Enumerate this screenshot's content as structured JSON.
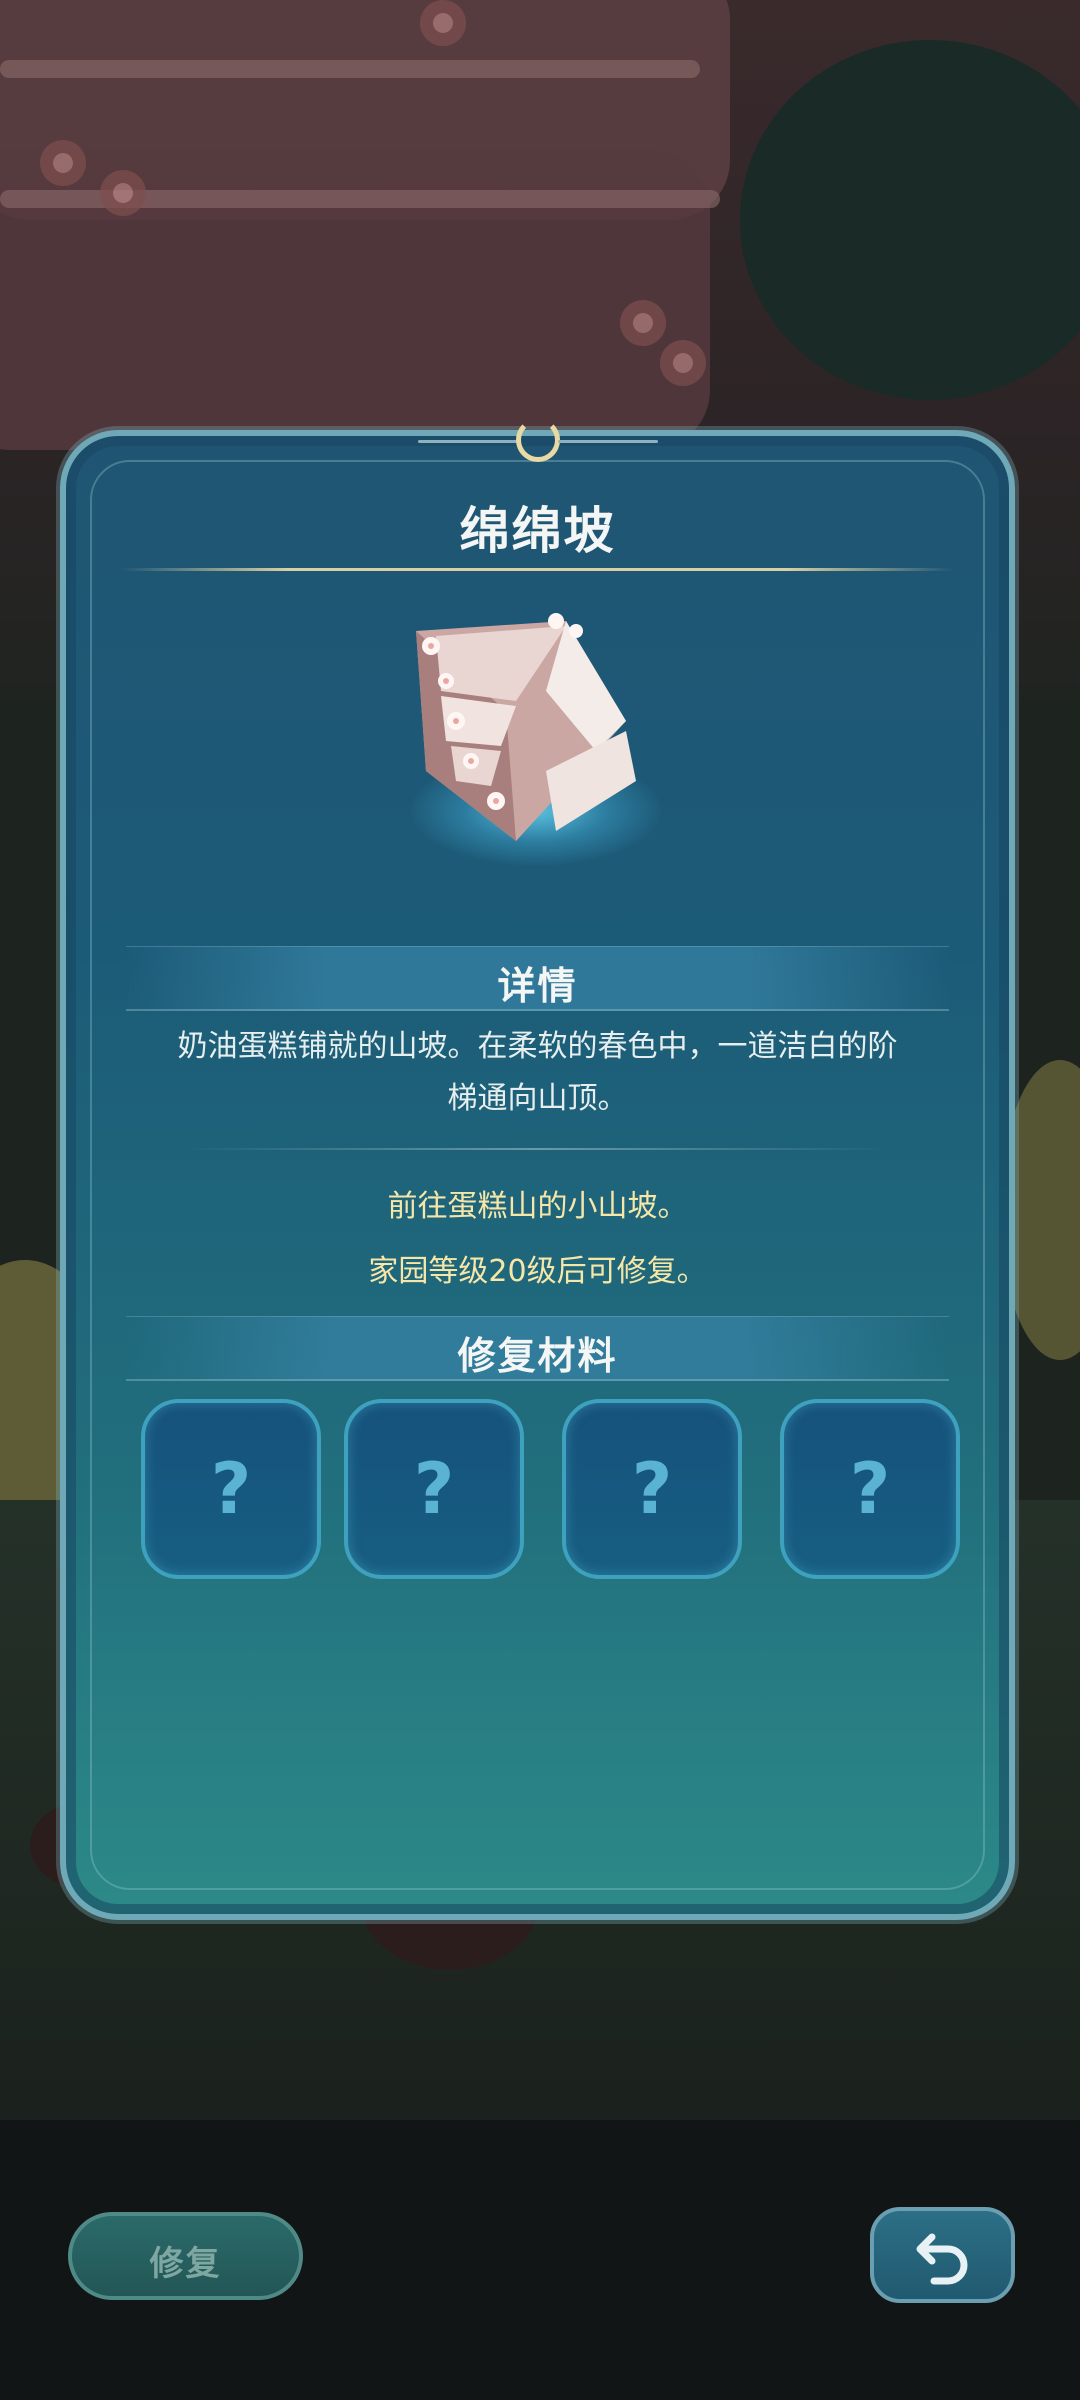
{
  "dialog": {
    "title": "绵绵坡",
    "illustration_icon": "cream-stairs-icon",
    "details_heading": "详情",
    "description_line1": "奶油蛋糕铺就的山坡。在柔软的春色中，一道洁白的阶",
    "description_line2": "梯通向山顶。",
    "hint_location": "前往蛋糕山的小山坡。",
    "hint_requirement": "家园等级20级后可修复。",
    "materials_heading": "修复材料",
    "material_slots": [
      "?",
      "?",
      "?",
      "?"
    ]
  },
  "footer": {
    "repair_label": "修复",
    "back_icon": "back-arrow-icon"
  },
  "colors": {
    "panel": "#1f5573",
    "accent_text": "#f6e7a8",
    "slot_border": "#3ea2bf"
  }
}
